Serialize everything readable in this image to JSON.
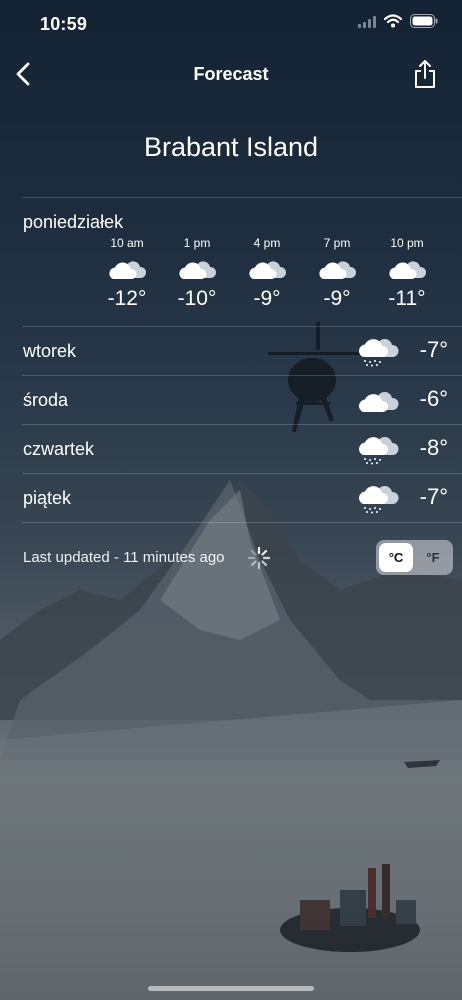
{
  "status_bar": {
    "time": "10:59",
    "icons": [
      "signal-icon",
      "wifi-icon",
      "battery-icon"
    ]
  },
  "nav": {
    "title": "Forecast",
    "back_icon": "chevron-left-icon",
    "share_icon": "share-icon"
  },
  "location": "Brabant Island",
  "today": {
    "label": "poniedziałek",
    "hours": [
      {
        "time": "10 am",
        "icon": "cloudy-icon",
        "temp": "-12°"
      },
      {
        "time": "1 pm",
        "icon": "cloudy-icon",
        "temp": "-10°"
      },
      {
        "time": "4 pm",
        "icon": "cloudy-icon",
        "temp": "-9°"
      },
      {
        "time": "7 pm",
        "icon": "cloudy-icon",
        "temp": "-9°"
      },
      {
        "time": "10 pm",
        "icon": "cloudy-icon",
        "temp": "-11°"
      }
    ]
  },
  "days": [
    {
      "name": "wtorek",
      "icon": "snow-cloud-icon",
      "temp": "-7°"
    },
    {
      "name": "środa",
      "icon": "cloudy-icon",
      "temp": "-6°"
    },
    {
      "name": "czwartek",
      "icon": "snow-cloud-icon",
      "temp": "-8°"
    },
    {
      "name": "piątek",
      "icon": "snow-cloud-icon",
      "temp": "-7°"
    }
  ],
  "footer": {
    "updated": "Last updated - 11 minutes ago",
    "units": {
      "celsius": "°C",
      "fahrenheit": "°F",
      "selected": "°C"
    }
  }
}
